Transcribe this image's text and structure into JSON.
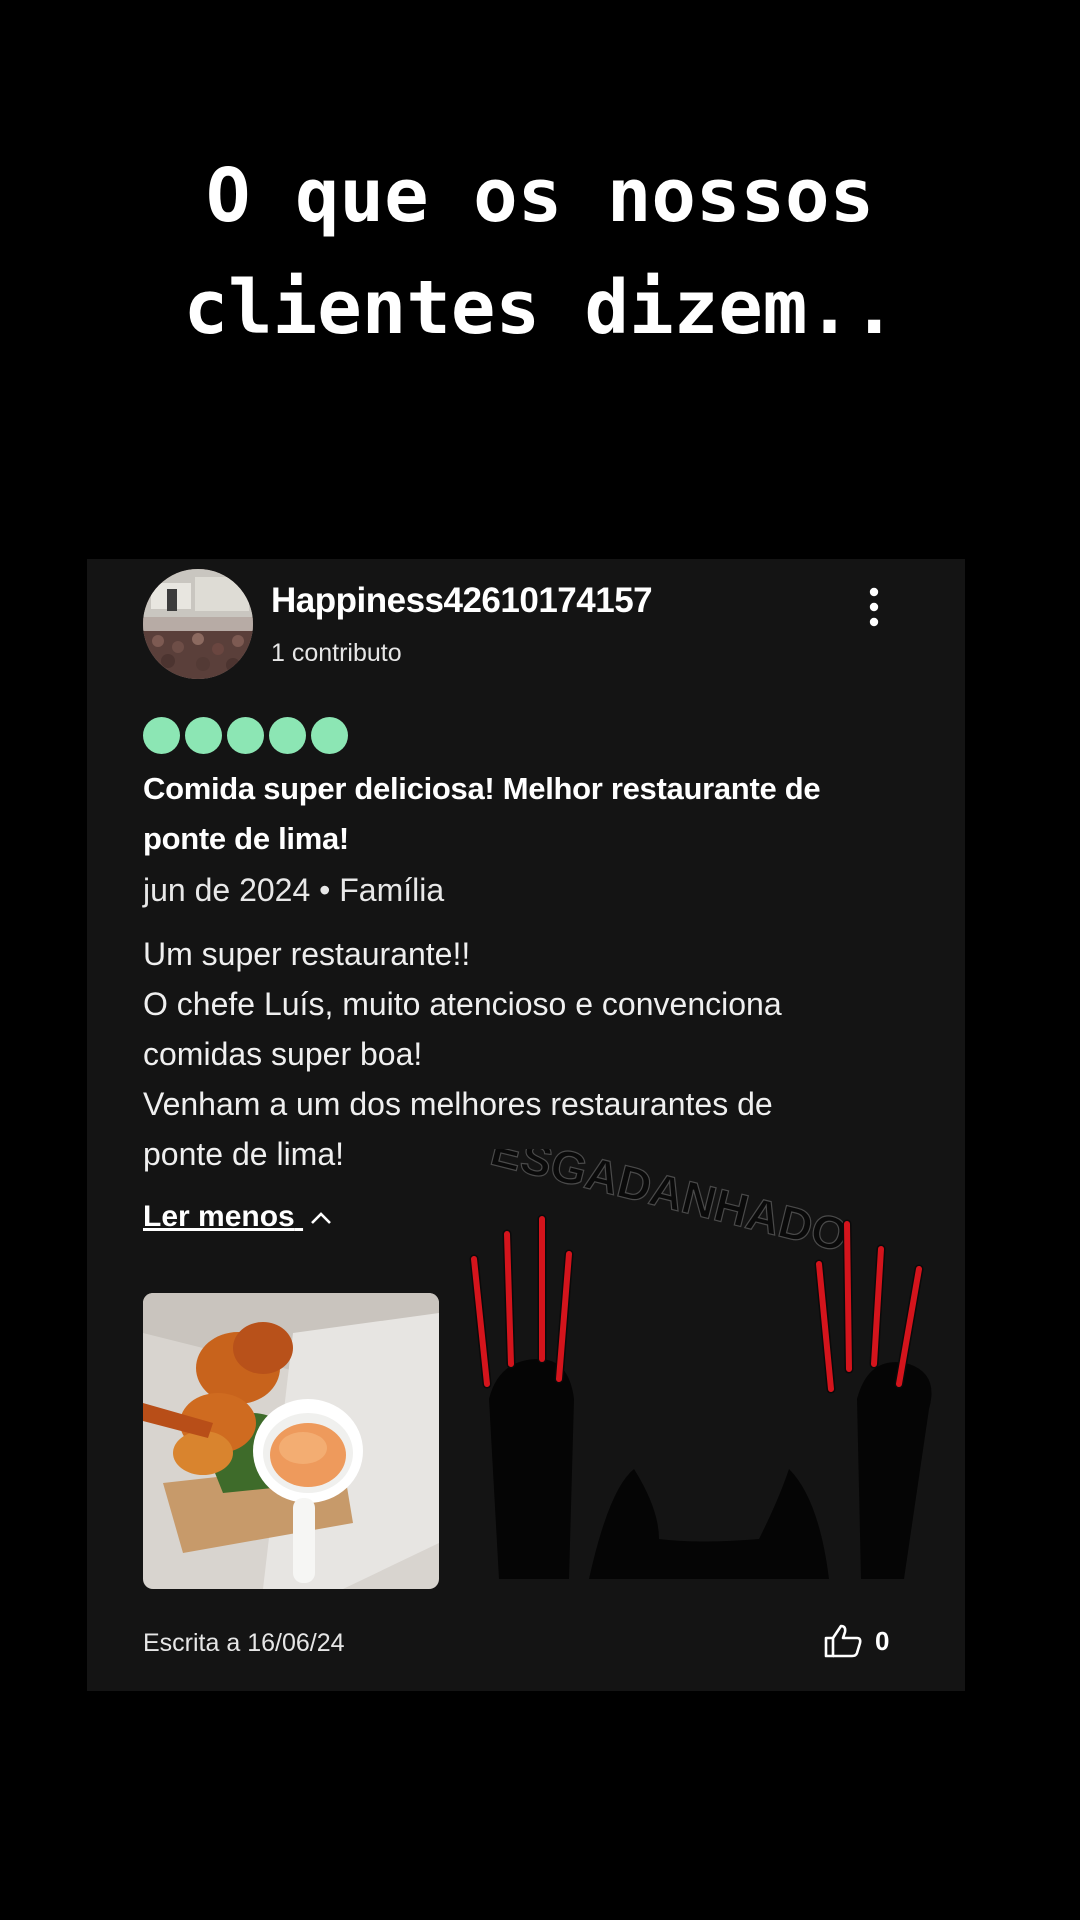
{
  "headline": {
    "line1": "O que os nossos",
    "line2": "clientes dizem.."
  },
  "review": {
    "user_name": "Happiness42610174157",
    "contributions": "1 contributo",
    "rating_bubbles": 5,
    "rating_color": "#8ce6b4",
    "title": "Comida super deliciosa! Melhor restaurante de ponte de lima!",
    "meta": "jun de 2024 • Família",
    "body_lines": [
      "Um super restaurante!!",
      "O chefe Luís, muito atencioso e convenciona",
      "comidas super boa!",
      "Venham a um dos melhores restaurantes de",
      "ponte de lima!"
    ],
    "read_less_label": "Ler menos",
    "written_date": "Escrita a 16/06/24",
    "helpful_count": "0"
  },
  "watermark": {
    "text": "ESGADANHADO",
    "accent": "#d4141c"
  },
  "icons": {
    "more": "more-vertical-icon",
    "read_less": "chevron-up-icon",
    "helpful": "thumbs-up-icon"
  }
}
